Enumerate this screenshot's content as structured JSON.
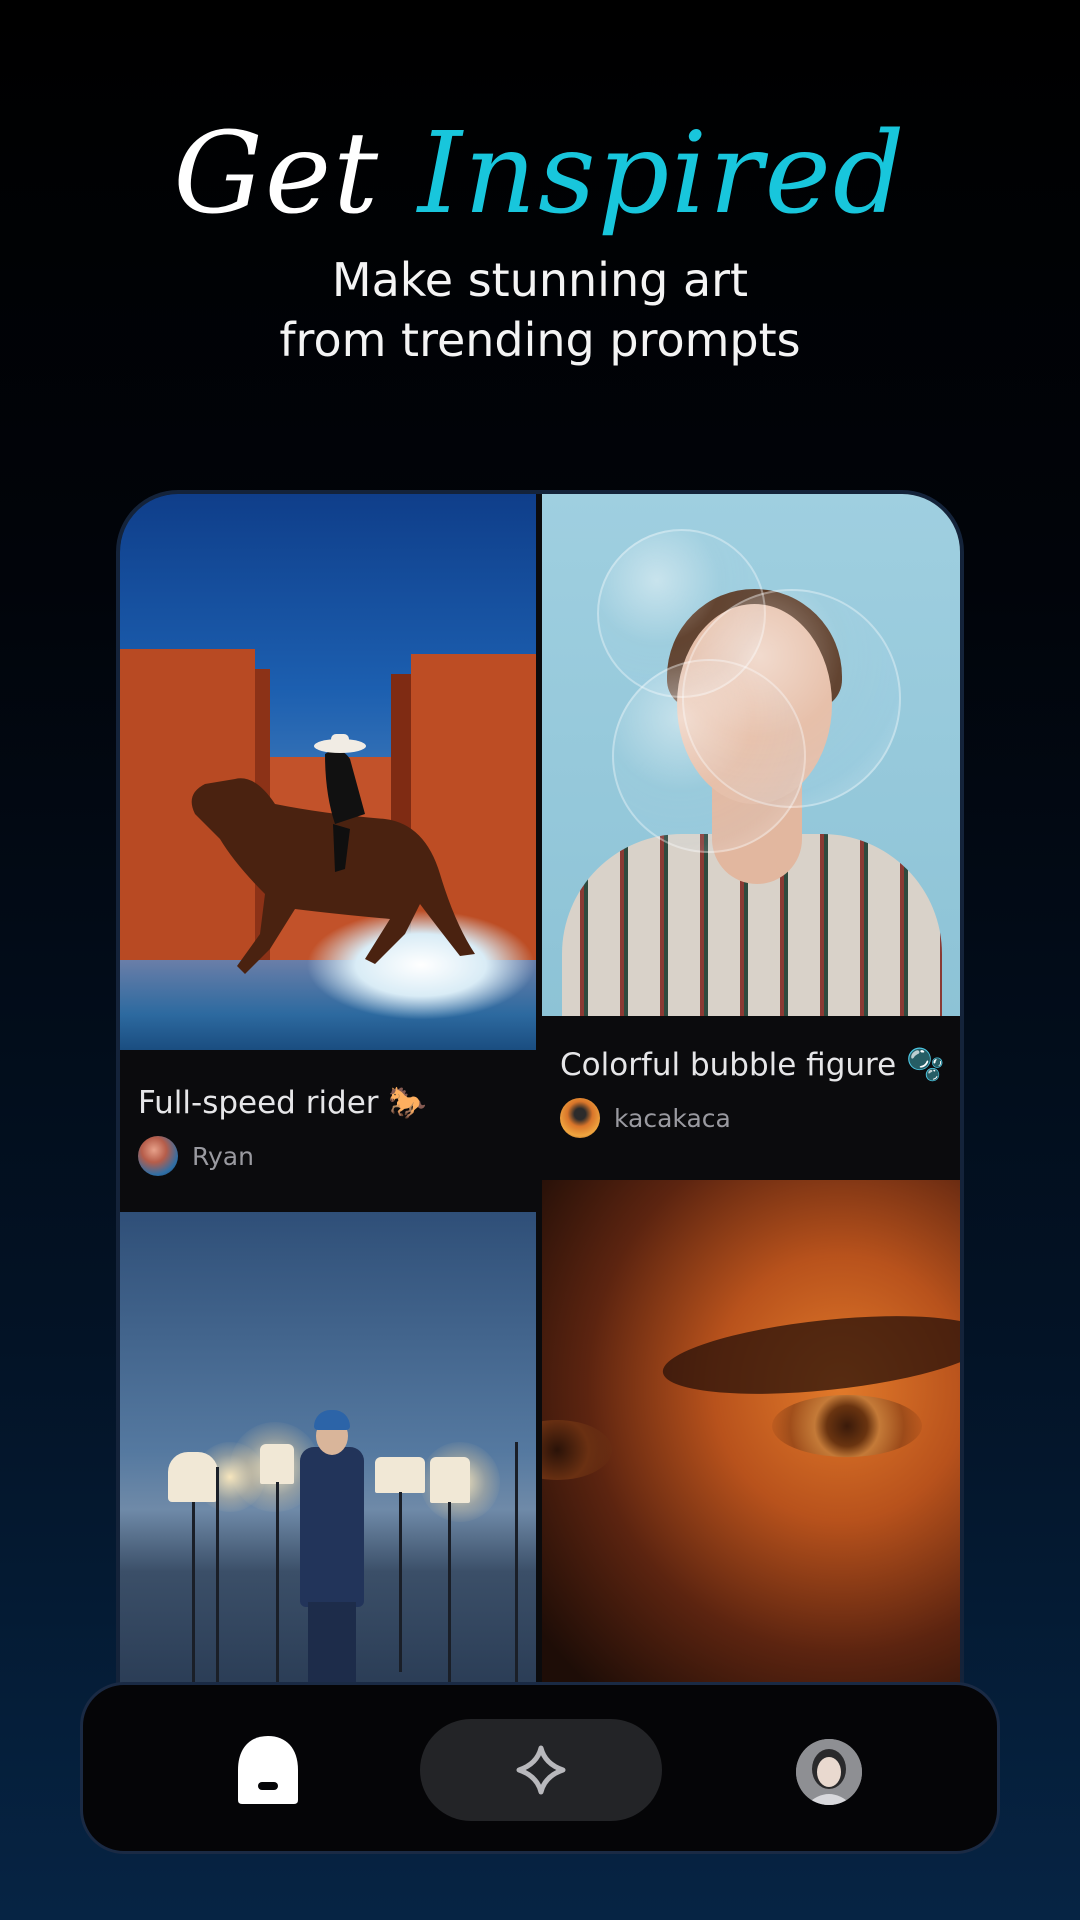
{
  "header": {
    "headline_white": "Get",
    "headline_accent": "Inspired",
    "subtitle_line1": "Make stunning art",
    "subtitle_line2": "from trending prompts"
  },
  "feed": {
    "cards": [
      {
        "title": "Full-speed rider 🐎",
        "author": "Ryan",
        "image": "horse-rider-photo"
      },
      {
        "title": "Colorful bubble figure 🫧",
        "author": "kacakaca",
        "image": "bubble-portrait-photo"
      },
      {
        "image": "lamps-man-photo"
      },
      {
        "image": "eye-closeup-photo"
      }
    ]
  },
  "nav": {
    "items": [
      "home-icon",
      "sparkle-icon",
      "profile-avatar"
    ],
    "active": "home-icon"
  },
  "colors": {
    "accent": "#18c6dc",
    "background": "#000000",
    "nav_pill": "#232427"
  }
}
